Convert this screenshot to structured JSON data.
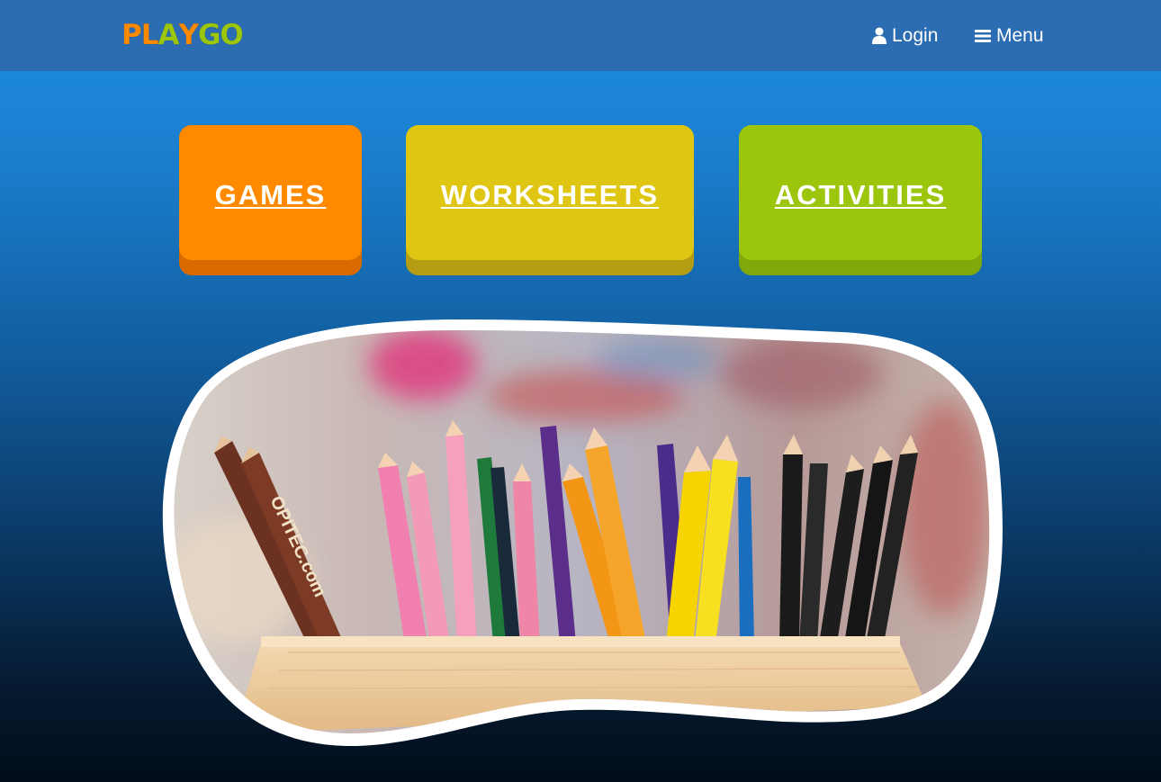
{
  "header": {
    "logo_letters": [
      {
        "ch": "P",
        "color": "#ff8a00"
      },
      {
        "ch": "L",
        "color": "#ff8a00"
      },
      {
        "ch": "A",
        "color": "#9cc60c"
      },
      {
        "ch": "Y",
        "color": "#ff8a00"
      },
      {
        "ch": "G",
        "color": "#9cc60c"
      },
      {
        "ch": "O",
        "color": "#9cc60c"
      }
    ],
    "logo_text": "PLAYGO",
    "login_label": "Login",
    "menu_label": "Menu"
  },
  "categories": [
    {
      "label": "GAMES",
      "color": "#ff8a00"
    },
    {
      "label": "WORKSHEETS",
      "color": "#dfc613"
    },
    {
      "label": "ACTIVITIES",
      "color": "#9cc60c"
    }
  ],
  "hero": {
    "image": "colored-pencils-in-wooden-box",
    "pencil_brand_text": "OPITEC.com"
  }
}
